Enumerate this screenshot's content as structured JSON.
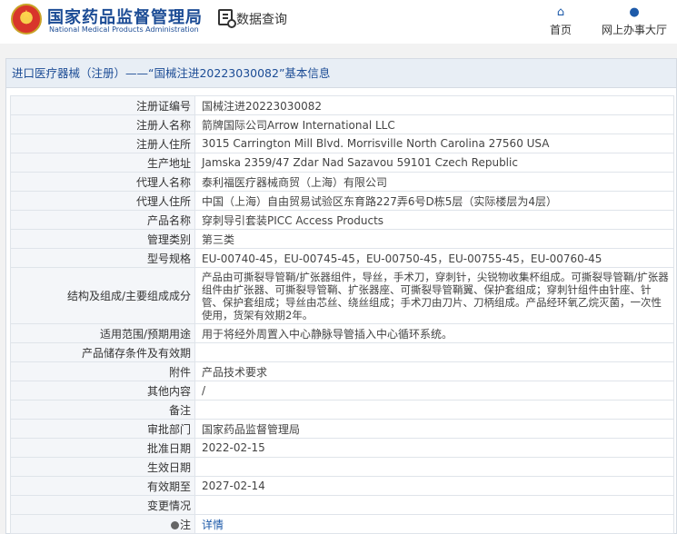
{
  "header": {
    "site_title": "国家药品监督管理局",
    "site_subtitle": "National Medical Products Administration",
    "query_label": "数据查询",
    "nav": [
      {
        "label": "首页",
        "icon": "home-icon"
      },
      {
        "label": "网上办事大厅",
        "icon": "user-icon"
      }
    ]
  },
  "panel": {
    "title": "进口医疗器械（注册）——“国械注进20223030082”基本信息"
  },
  "rows": [
    {
      "label": "注册证编号",
      "value": "国械注进20223030082"
    },
    {
      "label": "注册人名称",
      "value": "箭牌国际公司Arrow International LLC"
    },
    {
      "label": "注册人住所",
      "value": "3015 Carrington Mill Blvd. Morrisville North Carolina 27560 USA"
    },
    {
      "label": "生产地址",
      "value": "Jamska 2359/47 Zdar Nad Sazavou 59101 Czech Republic"
    },
    {
      "label": "代理人名称",
      "value": "泰利福医疗器械商贸（上海）有限公司"
    },
    {
      "label": "代理人住所",
      "value": "中国（上海）自由贸易试验区东育路227弄6号D栋5层（实际楼层为4层）"
    },
    {
      "label": "产品名称",
      "value": "穿刺导引套装PICC Access Products"
    },
    {
      "label": "管理类别",
      "value": "第三类"
    },
    {
      "label": "型号规格",
      "value": "EU-00740-45，EU-00745-45，EU-00750-45，EU-00755-45，EU-00760-45"
    },
    {
      "label": "结构及组成/主要组成成分",
      "value": "产品由可撕裂导管鞘/扩张器组件，导丝，手术刀，穿刺针，尖锐物收集杯组成。可撕裂导管鞘/扩张器组件由扩张器、可撕裂导管鞘、扩张器座、可撕裂导管鞘翼、保护套组成；穿刺针组件由针座、针管、保护套组成；导丝由芯丝、绕丝组成；手术刀由刀片、刀柄组成。产品经环氧乙烷灭菌，一次性使用，货架有效期2年。"
    },
    {
      "label": "适用范围/预期用途",
      "value": "用于将经外周置入中心静脉导管插入中心循环系统。"
    },
    {
      "label": "产品储存条件及有效期",
      "value": ""
    },
    {
      "label": "附件",
      "value": "产品技术要求"
    },
    {
      "label": "其他内容",
      "value": "/"
    },
    {
      "label": "备注",
      "value": ""
    },
    {
      "label": "审批部门",
      "value": "国家药品监督管理局"
    },
    {
      "label": "批准日期",
      "value": "2022-02-15"
    },
    {
      "label": "生效日期",
      "value": ""
    },
    {
      "label": "有效期至",
      "value": "2027-02-14"
    },
    {
      "label": "变更情况",
      "value": ""
    },
    {
      "label": "注",
      "value": "详情"
    }
  ]
}
